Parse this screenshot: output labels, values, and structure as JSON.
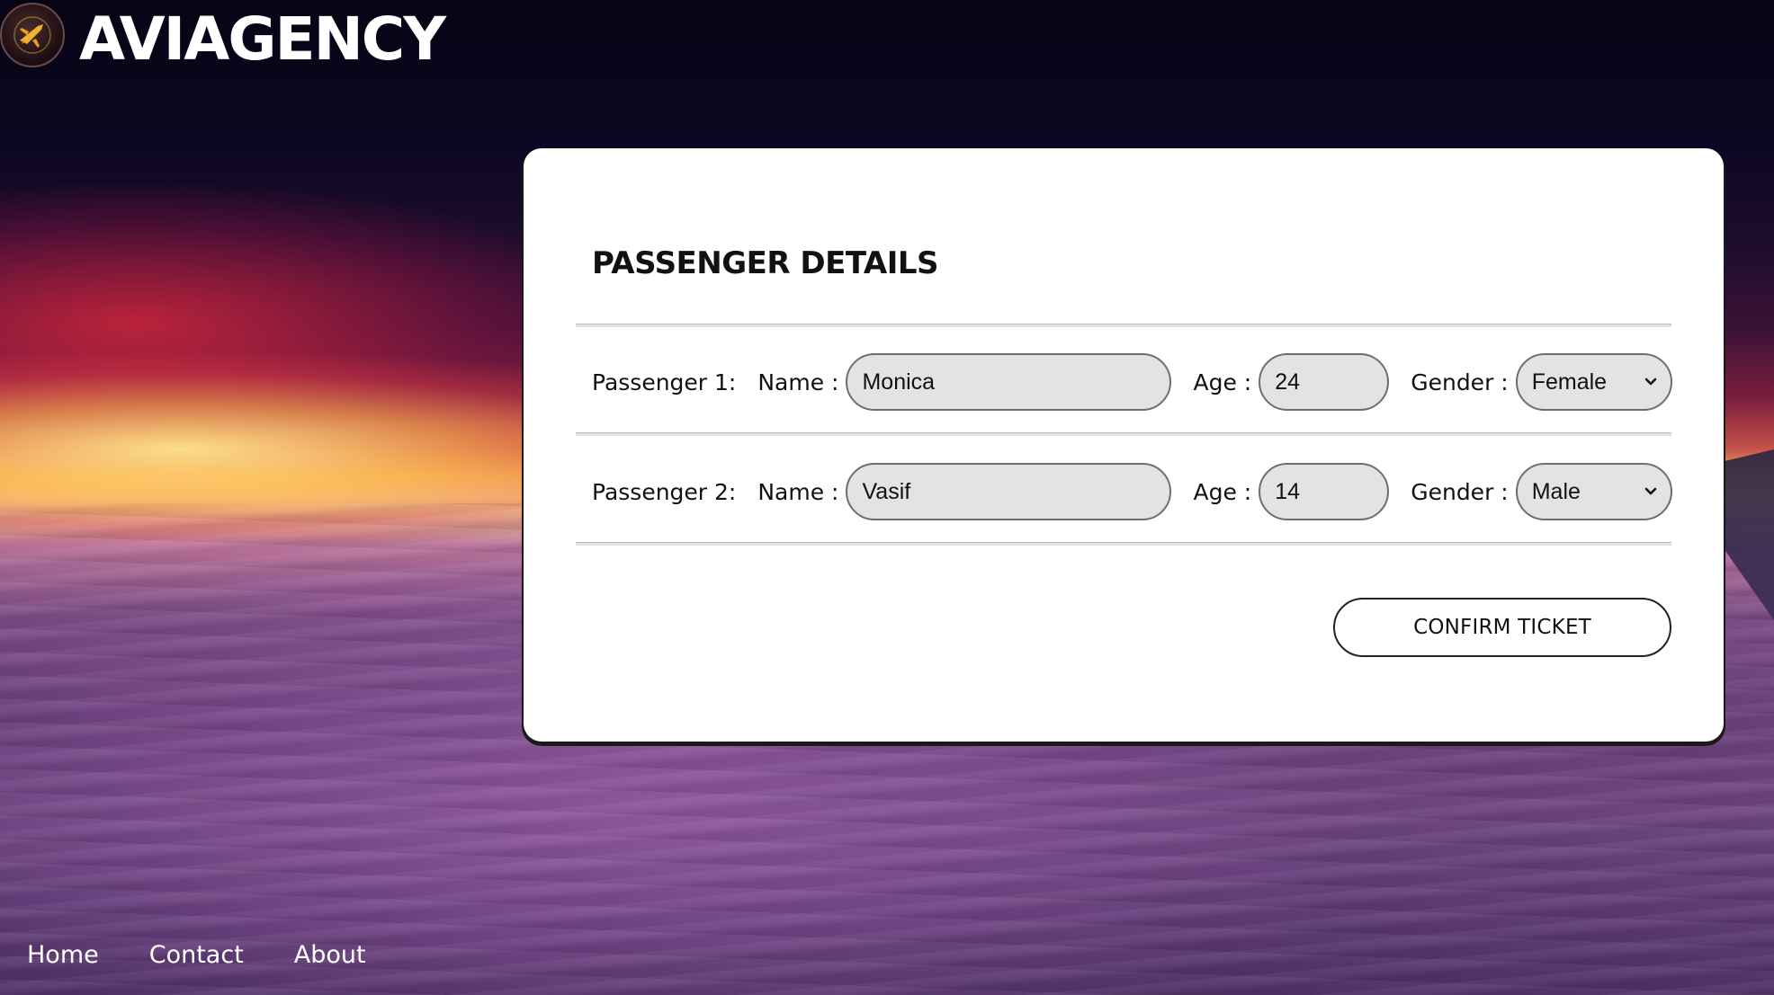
{
  "brand": {
    "name": "AVIAGENCY"
  },
  "card": {
    "title": "PASSENGER DETAILS",
    "field_labels": {
      "name": "Name :",
      "age": "Age :",
      "gender": "Gender :"
    },
    "passengers": [
      {
        "label": "Passenger 1:",
        "name": "Monica",
        "age": "24",
        "gender": "Female"
      },
      {
        "label": "Passenger 2:",
        "name": "Vasif",
        "age": "14",
        "gender": "Male"
      }
    ],
    "confirm_label": "CONFIRM TICKET"
  },
  "nav": {
    "items": [
      "Home",
      "Contact",
      "About"
    ]
  }
}
